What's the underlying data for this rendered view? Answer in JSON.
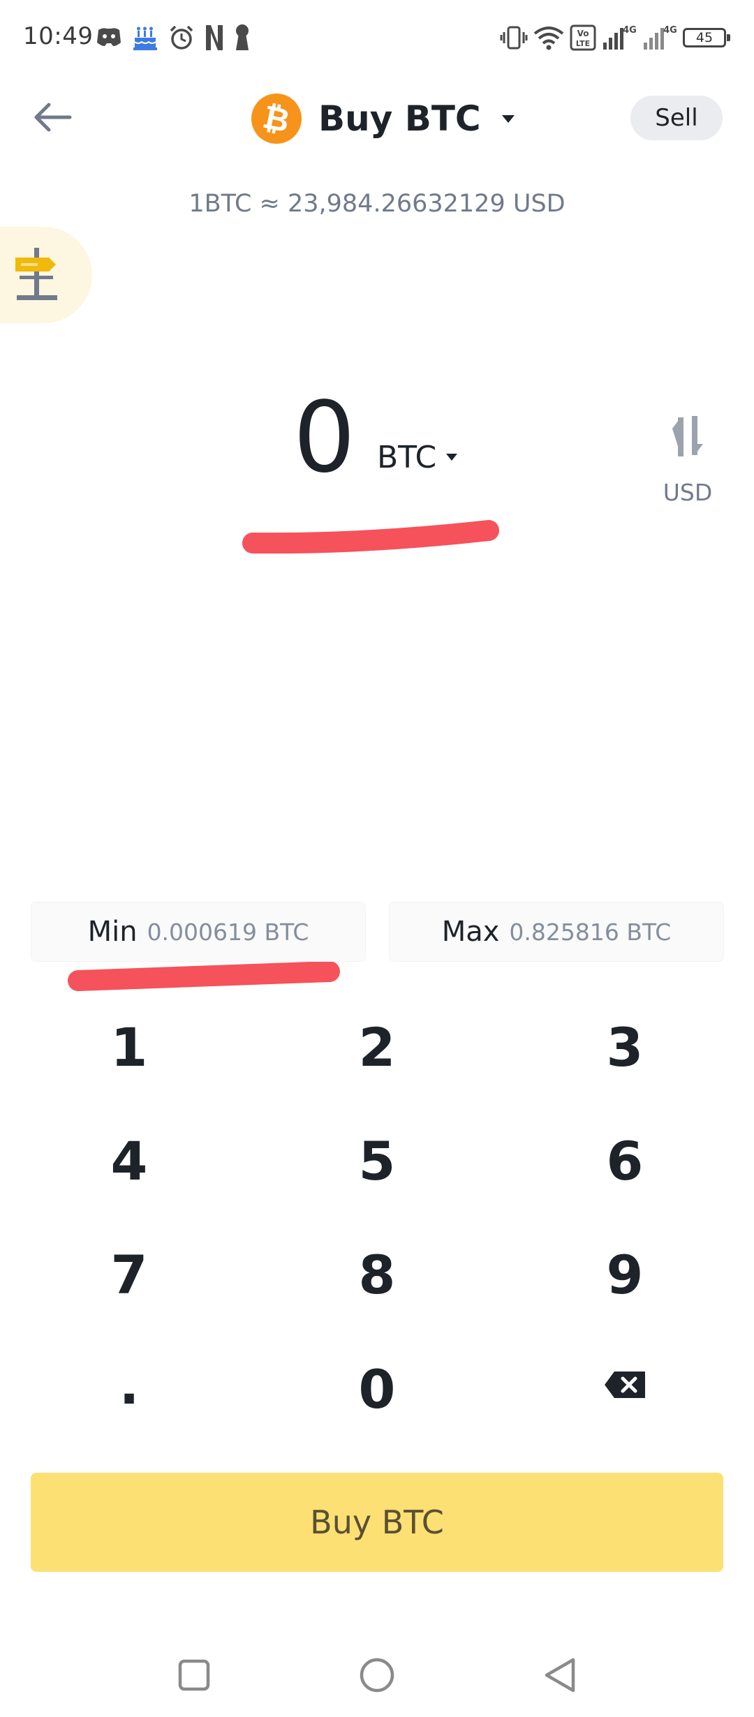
{
  "status_bar": {
    "time": "10:49",
    "left_icons": [
      "discord-icon",
      "cake-icon",
      "alarm-icon",
      "netflix-icon",
      "keyhole-icon"
    ],
    "right_icons": [
      "vibrate-icon",
      "wifi-icon",
      "volte-icon",
      "signal-icon",
      "signal-icon"
    ],
    "network_1": "4G",
    "network_2": "4G",
    "volte": "Vo LTE",
    "battery": "45"
  },
  "header": {
    "title": "Buy BTC",
    "coin_symbol": "₿",
    "sell_label": "Sell"
  },
  "rate": {
    "text": "1BTC ≈ 23,984.26632129 USD"
  },
  "amount": {
    "value": "0",
    "currency": "BTC",
    "swap_currency": "USD"
  },
  "limits": {
    "min_label": "Min",
    "min_value": "0.000619 BTC",
    "max_label": "Max",
    "max_value": "0.825816 BTC"
  },
  "keypad": {
    "keys": [
      "1",
      "2",
      "3",
      "4",
      "5",
      "6",
      "7",
      "8",
      "9",
      ".",
      "0"
    ]
  },
  "primary_button": {
    "label": "Buy BTC"
  },
  "colors": {
    "accent": "#fce073",
    "coin": "#f7931a",
    "highlight_stroke": "#f5424d",
    "text_primary": "#1e2329",
    "text_secondary": "#707a8a"
  }
}
